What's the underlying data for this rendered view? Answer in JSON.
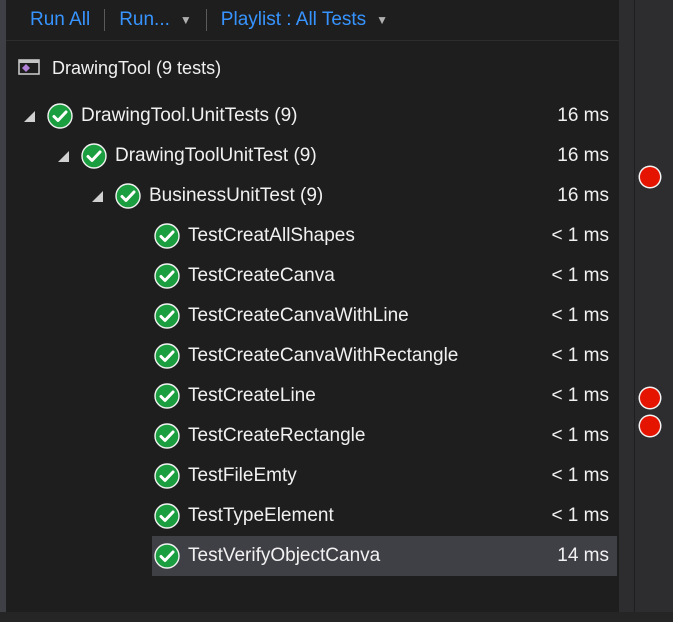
{
  "toolbar": {
    "run_all": "Run All",
    "run": "Run...",
    "playlist": "Playlist : All Tests"
  },
  "header": {
    "project_label": "DrawingTool (9 tests)"
  },
  "tree": [
    {
      "label": "DrawingTool.UnitTests (9)",
      "duration": "16 ms",
      "level": 0,
      "expanded": true,
      "status": "passed"
    },
    {
      "label": "DrawingToolUnitTest (9)",
      "duration": "16 ms",
      "level": 1,
      "expanded": true,
      "status": "passed"
    },
    {
      "label": "BusinessUnitTest (9)",
      "duration": "16 ms",
      "level": 2,
      "expanded": true,
      "status": "passed"
    },
    {
      "label": "TestCreatAllShapes",
      "duration": "< 1 ms",
      "level": 3,
      "status": "passed"
    },
    {
      "label": "TestCreateCanva",
      "duration": "< 1 ms",
      "level": 3,
      "status": "passed"
    },
    {
      "label": "TestCreateCanvaWithLine",
      "duration": "< 1 ms",
      "level": 3,
      "status": "passed"
    },
    {
      "label": "TestCreateCanvaWithRectangle",
      "duration": "< 1 ms",
      "level": 3,
      "status": "passed"
    },
    {
      "label": "TestCreateLine",
      "duration": "< 1 ms",
      "level": 3,
      "status": "passed"
    },
    {
      "label": "TestCreateRectangle",
      "duration": "< 1 ms",
      "level": 3,
      "status": "passed"
    },
    {
      "label": "TestFileEmty",
      "duration": "< 1 ms",
      "level": 3,
      "status": "passed"
    },
    {
      "label": "TestTypeElement",
      "duration": "< 1 ms",
      "level": 3,
      "status": "passed"
    },
    {
      "label": "TestVerifyObjectCanva",
      "duration": "14 ms",
      "level": 3,
      "status": "passed",
      "selected": true
    }
  ],
  "colors": {
    "pass_green": "#1a9e3f",
    "link_blue": "#3794ff",
    "breakpoint_red": "#e51400"
  }
}
